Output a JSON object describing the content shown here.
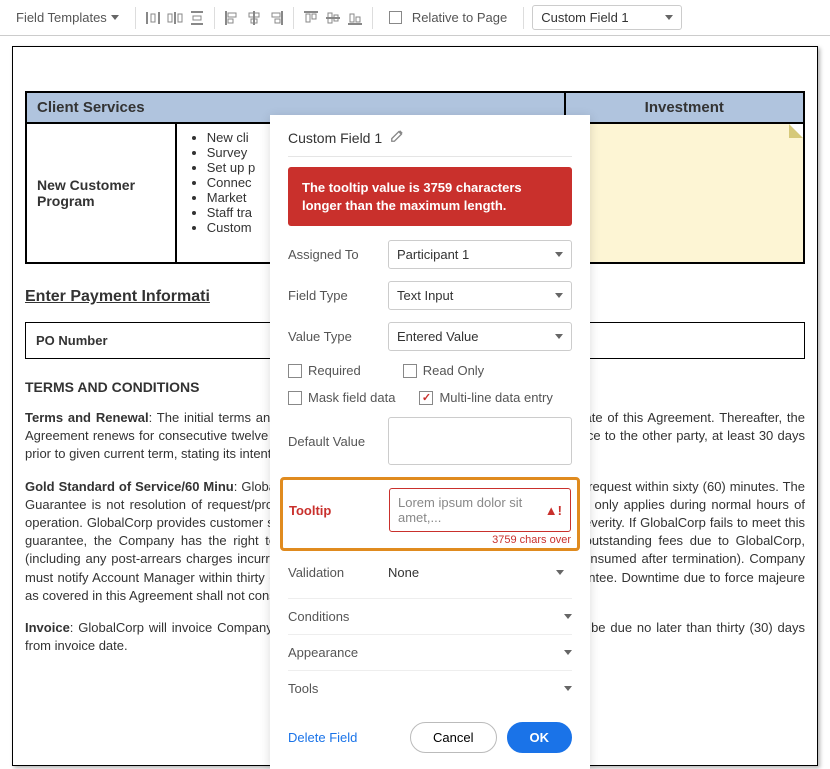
{
  "toolbar": {
    "field_templates_label": "Field Templates",
    "relative_to_page_label": "Relative to Page",
    "dropdown_value": "Custom Field 1"
  },
  "doc": {
    "client_services_header": "Client Services",
    "investment_header": "Investment",
    "program_label": "New Customer Program",
    "bullets": [
      "New cli",
      "Survey",
      "Set up p",
      "Connec",
      "Market",
      "Staff tra",
      "Custom"
    ],
    "payment_section_title": "Enter Payment Informati",
    "po_number_label": "PO Number",
    "terms_heading": "TERMS AND CONDITIONS",
    "para1_label": "Terms and Renewal",
    "para1_text": ": The initial terms and conditions apply commencing upon the execution date of this Agreement. Thereafter, the Agreement renews for consecutive twelve (12) month terms unless either party gives written notice to the other party, at least 30 days prior to given current term, stating its intent to terminate this Agreement.",
    "para2_label": "Gold Standard of Service/60 Minu",
    "para2_text": ": GlobalCorp will respond to any Company customer support request within sixty (60) minutes. The Guarantee is not resolution of request/problem only confirmation of the request. The guarantee only applies during normal hours of operation. GlobalCorp provides customer support 24/7/365 at (800)-888-8888 for issues of any severity. If GlobalCorp fails to meet this guarantee, the Company has the right to terminate this Agreement, upon repayment of all outstanding fees due to GlobalCorp, (including any post-arrears charges incurred prior to the termination that are scheduled to be consumed after termination). Company must notify Account Manager within thirty (30) days of any occasion of failure to meet this Guarantee. Downtime due to force majeure as covered in this Agreement shall not constitute a violation of this",
    "para3_label": "Invoice",
    "para3_text": ": GlobalCorp will invoice Company upon execution of the Agreement and payment shall be due no later than thirty (30) days from invoice date."
  },
  "panel": {
    "title": "Custom Field 1",
    "error_message": "The tooltip value is 3759 characters longer than the maximum length.",
    "assigned_to_label": "Assigned To",
    "assigned_to_value": "Participant 1",
    "field_type_label": "Field Type",
    "field_type_value": "Text Input",
    "value_type_label": "Value Type",
    "value_type_value": "Entered Value",
    "required_label": "Required",
    "readonly_label": "Read Only",
    "mask_label": "Mask field data",
    "multiline_label": "Multi-line data entry",
    "default_value_label": "Default Value",
    "tooltip_label": "Tooltip",
    "tooltip_value": "Lorem ipsum dolor sit amet,...",
    "tooltip_chars_over": "3759 chars over",
    "validation_label": "Validation",
    "validation_value": "None",
    "conditions_label": "Conditions",
    "appearance_label": "Appearance",
    "tools_label": "Tools",
    "delete_label": "Delete Field",
    "cancel_label": "Cancel",
    "ok_label": "OK"
  }
}
